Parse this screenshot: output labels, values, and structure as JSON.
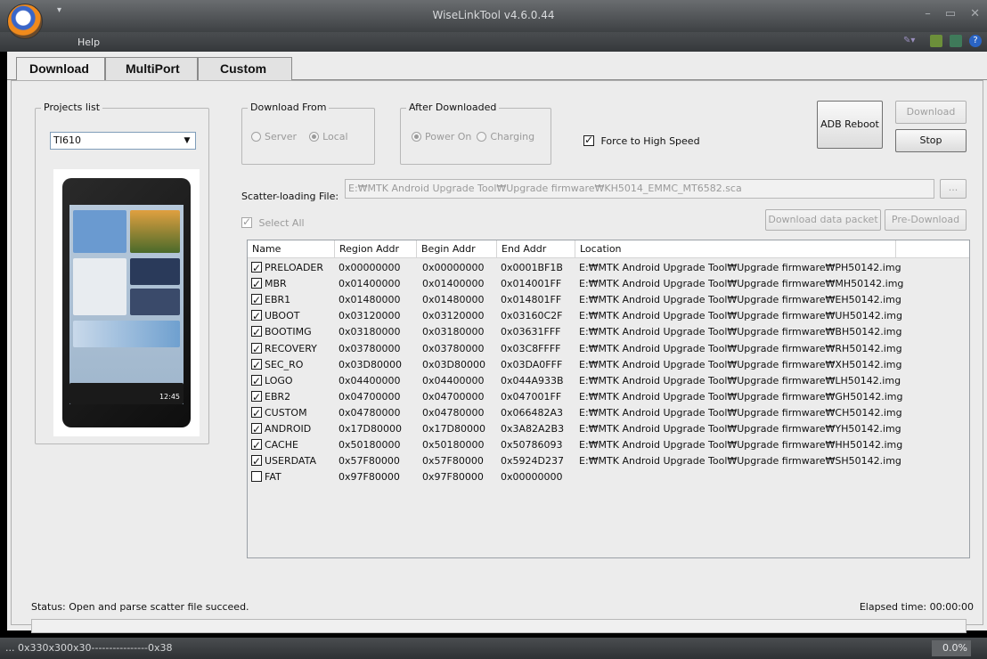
{
  "window": {
    "title": "WiseLinkTool v4.6.0.44"
  },
  "menu": {
    "help": "Help"
  },
  "tabs": [
    {
      "label": "Download"
    },
    {
      "label": "MultiPort"
    },
    {
      "label": "Custom"
    }
  ],
  "projects": {
    "title": "Projects list",
    "selected": "TI610"
  },
  "download_from": {
    "title": "Download From",
    "server": "Server",
    "local": "Local",
    "selected": "local"
  },
  "after_downloaded": {
    "title": "After Downloaded",
    "power_on": "Power On",
    "charging": "Charging",
    "selected": "power_on"
  },
  "force_high_speed": {
    "label": "Force to High Speed",
    "checked": true
  },
  "buttons": {
    "adb_reboot": "ADB Reboot",
    "download": "Download",
    "stop": "Stop",
    "browse": "...",
    "download_data_packet": "Download data packet",
    "pre_download": "Pre-Download"
  },
  "scatter": {
    "label": "Scatter-loading File:",
    "value": "E:₩MTK Android Upgrade Tool₩Upgrade firmware₩KH5014_EMMC_MT6582.sca"
  },
  "select_all": {
    "label": "Select All",
    "checked": true
  },
  "table": {
    "columns": [
      "Name",
      "Region Addr",
      "Begin Addr",
      "End Addr",
      "Location"
    ],
    "rows": [
      {
        "checked": true,
        "name": "PRELOADER",
        "region": "0x00000000",
        "begin": "0x00000000",
        "end": "0x0001BF1B",
        "location": "E:₩MTK Android Upgrade Tool₩Upgrade firmware₩PH50142.img"
      },
      {
        "checked": true,
        "name": "MBR",
        "region": "0x01400000",
        "begin": "0x01400000",
        "end": "0x014001FF",
        "location": "E:₩MTK Android Upgrade Tool₩Upgrade firmware₩MH50142.img"
      },
      {
        "checked": true,
        "name": "EBR1",
        "region": "0x01480000",
        "begin": "0x01480000",
        "end": "0x014801FF",
        "location": "E:₩MTK Android Upgrade Tool₩Upgrade firmware₩EH50142.img"
      },
      {
        "checked": true,
        "name": "UBOOT",
        "region": "0x03120000",
        "begin": "0x03120000",
        "end": "0x03160C2F",
        "location": "E:₩MTK Android Upgrade Tool₩Upgrade firmware₩UH50142.img"
      },
      {
        "checked": true,
        "name": "BOOTIMG",
        "region": "0x03180000",
        "begin": "0x03180000",
        "end": "0x03631FFF",
        "location": "E:₩MTK Android Upgrade Tool₩Upgrade firmware₩BH50142.img"
      },
      {
        "checked": true,
        "name": "RECOVERY",
        "region": "0x03780000",
        "begin": "0x03780000",
        "end": "0x03C8FFFF",
        "location": "E:₩MTK Android Upgrade Tool₩Upgrade firmware₩RH50142.img"
      },
      {
        "checked": true,
        "name": "SEC_RO",
        "region": "0x03D80000",
        "begin": "0x03D80000",
        "end": "0x03DA0FFF",
        "location": "E:₩MTK Android Upgrade Tool₩Upgrade firmware₩XH50142.img"
      },
      {
        "checked": true,
        "name": "LOGO",
        "region": "0x04400000",
        "begin": "0x04400000",
        "end": "0x044A933B",
        "location": "E:₩MTK Android Upgrade Tool₩Upgrade firmware₩LH50142.img"
      },
      {
        "checked": true,
        "name": "EBR2",
        "region": "0x04700000",
        "begin": "0x04700000",
        "end": "0x047001FF",
        "location": "E:₩MTK Android Upgrade Tool₩Upgrade firmware₩GH50142.img"
      },
      {
        "checked": true,
        "name": "CUSTOM",
        "region": "0x04780000",
        "begin": "0x04780000",
        "end": "0x066482A3",
        "location": "E:₩MTK Android Upgrade Tool₩Upgrade firmware₩CH50142.img"
      },
      {
        "checked": true,
        "name": "ANDROID",
        "region": "0x17D80000",
        "begin": "0x17D80000",
        "end": "0x3A82A2B3",
        "location": "E:₩MTK Android Upgrade Tool₩Upgrade firmware₩YH50142.img"
      },
      {
        "checked": true,
        "name": "CACHE",
        "region": "0x50180000",
        "begin": "0x50180000",
        "end": "0x50786093",
        "location": "E:₩MTK Android Upgrade Tool₩Upgrade firmware₩HH50142.img"
      },
      {
        "checked": true,
        "name": "USERDATA",
        "region": "0x57F80000",
        "begin": "0x57F80000",
        "end": "0x5924D237",
        "location": "E:₩MTK Android Upgrade Tool₩Upgrade firmware₩SH50142.img"
      },
      {
        "checked": false,
        "name": "FAT",
        "region": "0x97F80000",
        "begin": "0x97F80000",
        "end": "0x00000000",
        "location": ""
      }
    ]
  },
  "status": {
    "text": "Status:  Open and parse scatter file succeed.",
    "elapsed": "Elapsed time: 00:00:00",
    "progress": 0
  },
  "statusbar": {
    "left": "... 0x330x300x30----------------0x38",
    "right": "0.0%"
  },
  "phone_screen": {
    "clock": "12:45"
  },
  "colors": {
    "accent_orb_blue": "#3a66c8",
    "accent_orb_orange": "#f08a1c",
    "titlebar": "#4a4d50"
  }
}
